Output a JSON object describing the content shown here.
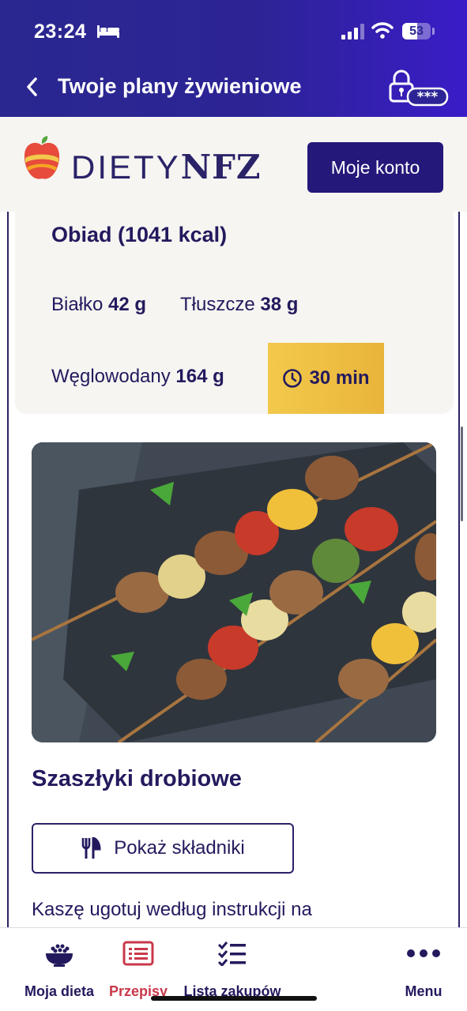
{
  "status_bar": {
    "time": "23:24",
    "battery": "53",
    "battery_level": 0.53
  },
  "nav": {
    "title": "Twoje plany żywieniowe",
    "lock_dots": "***"
  },
  "brand": {
    "logo_light": "DIETY",
    "logo_bold": "NFZ",
    "account_button": "Moje konto"
  },
  "meal": {
    "title": "Obiad (1041 kcal)",
    "protein_label": "Białko",
    "protein_value": "42 g",
    "fat_label": "Tłuszcze",
    "fat_value": "38 g",
    "carbs_label": "Węglowodany",
    "carbs_value": "164 g",
    "prep_time": "30 min"
  },
  "recipe": {
    "title": "Szaszłyki drobiowe",
    "ingredients_button": "Pokaż składniki",
    "instructions_start": "Kaszę ugotuj według instrukcji na"
  },
  "tabs": [
    {
      "label": "Moja dieta",
      "icon": "bowl-icon"
    },
    {
      "label": "Przepisy",
      "icon": "recipe-list-icon"
    },
    {
      "label": "Lista zakupów",
      "icon": "checklist-icon"
    },
    {
      "label": "Menu",
      "icon": "more-dots-icon"
    }
  ],
  "colors": {
    "brand_dark": "#24187a",
    "accent_red": "#c9384a",
    "badge_gold": "#f2c94c",
    "header_gradient_end": "#3a1cc7"
  }
}
